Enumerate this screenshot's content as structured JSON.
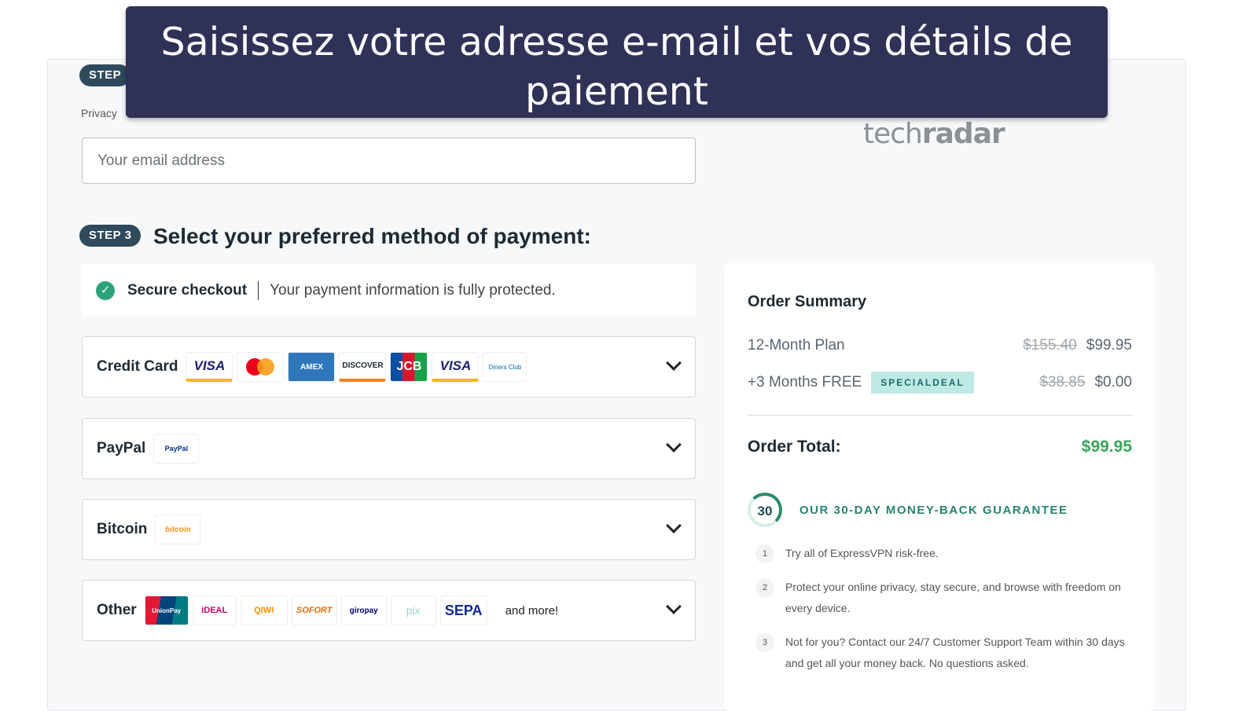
{
  "banner": {
    "text": "Saisissez votre adresse e-mail et vos détails de paiement"
  },
  "step2": {
    "badge": "STEP",
    "privacy_text": "Privacy",
    "email_placeholder": "Your email address"
  },
  "logo": {
    "light": "tech",
    "bold": "radar"
  },
  "step3": {
    "badge": "STEP 3",
    "title": "Select your preferred method of payment:"
  },
  "secure": {
    "title": "Secure checkout",
    "text": "Your payment information is fully protected."
  },
  "payments": [
    {
      "label": "Credit Card",
      "logos": [
        "VISA",
        "MC",
        "AMEX",
        "DISCOVER",
        "JCB",
        "VISA",
        "Diners Club"
      ]
    },
    {
      "label": "PayPal",
      "logos": [
        "PayPal"
      ]
    },
    {
      "label": "Bitcoin",
      "logos": [
        "bitcoin"
      ]
    },
    {
      "label": "Other",
      "logos": [
        "UnionPay",
        "iDEAL",
        "QIWI",
        "SOFORT",
        "giropay",
        "pix",
        "SEPA"
      ],
      "more": "and more!"
    }
  ],
  "summary": {
    "title": "Order Summary",
    "plan": {
      "label": "12-Month Plan",
      "old": "$155.40",
      "price": "$99.95"
    },
    "bonus": {
      "label": "+3 Months FREE",
      "badge": "SPECIALDEAL",
      "old": "$38.85",
      "price": "$0.00"
    },
    "total_label": "Order Total:",
    "total": "$99.95",
    "guarantee_number": "30",
    "guarantee": "OUR 30-DAY MONEY-BACK GUARANTEE",
    "points": [
      {
        "n": "1",
        "text": "Try all of ExpressVPN risk-free."
      },
      {
        "n": "2",
        "text": "Protect your online privacy, stay secure, and browse with freedom on every device."
      },
      {
        "n": "3",
        "text": "Not for you? Contact our 24/7 Customer Support Team within 30 days and get all your money back. No questions asked."
      }
    ]
  },
  "colors": {
    "banner": "#2f3157",
    "badge": "#2e4a5b",
    "accent_green": "#3aa55b",
    "teal": "#2a8273"
  }
}
